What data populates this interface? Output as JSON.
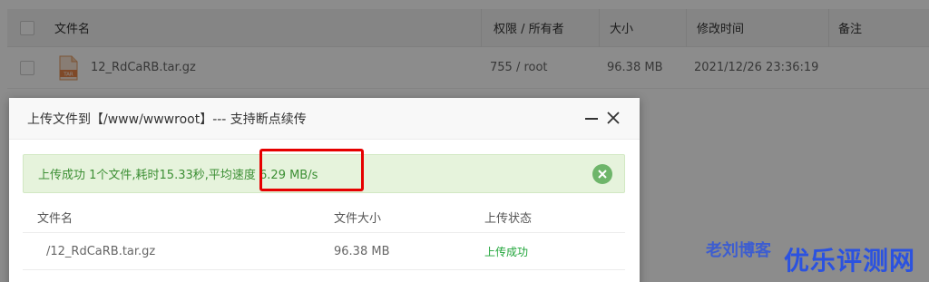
{
  "table": {
    "headers": {
      "filename": "文件名",
      "permission": "权限 / 所有者",
      "size": "大小",
      "modified": "修改时间",
      "note": "备注"
    },
    "rows": [
      {
        "name": "12_RdCaRB.tar.gz",
        "icon_label": "TAR",
        "permission": "755 / root",
        "size": "96.38 MB",
        "modified": "2021/12/26 23:36:19",
        "note": ""
      }
    ]
  },
  "dialog": {
    "title": "上传文件到【/www/wwwroot】--- 支持断点续传",
    "alert_text": "上传成功 1个文件,耗时15.33秒,平均速度 6.29 MB/s",
    "list_headers": {
      "name": "文件名",
      "size": "文件大小",
      "status": "上传状态"
    },
    "list_rows": [
      {
        "name": "/12_RdCaRB.tar.gz",
        "size": "96.38 MB",
        "status": "上传成功"
      }
    ]
  },
  "watermark": {
    "small": "老刘博客",
    "large": "优乐评测网"
  },
  "colors": {
    "success": "#20a53a",
    "alert_bg": "#e6f3dc",
    "highlight": "#e60000"
  }
}
